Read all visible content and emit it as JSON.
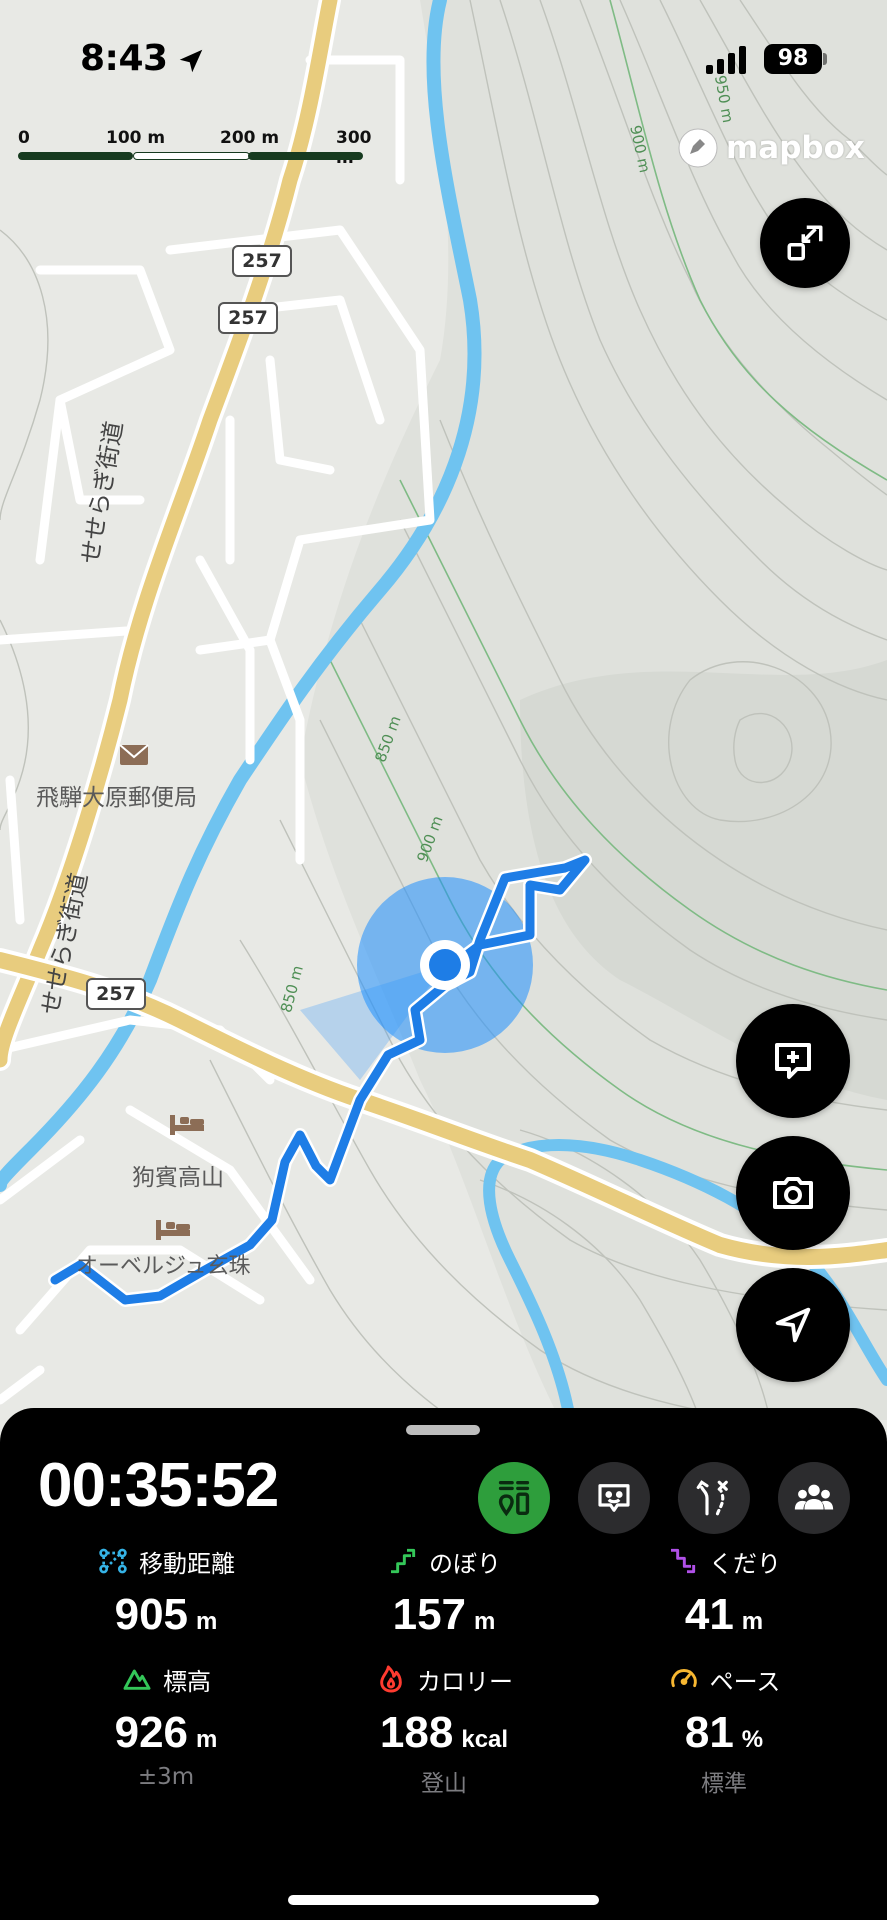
{
  "status_bar": {
    "time": "8:43",
    "battery": "98"
  },
  "map": {
    "scale_labels": [
      "0",
      "100 m",
      "200 m",
      "300 m"
    ],
    "attribution": "mapbox",
    "road_labels": [
      "257",
      "257",
      "257"
    ],
    "street_name": "せせらぎ街道",
    "poi": {
      "post_office": "飛騨大原郵便局",
      "lodging_1": "狗賓高山",
      "lodging_2": "オーベルジュ玄珠"
    },
    "contours": [
      "950 m",
      "900 m",
      "850 m",
      "900 m",
      "850 m"
    ]
  },
  "recording": {
    "elapsed": "00:35:52",
    "stats": [
      {
        "label": "移動距離",
        "value": "905",
        "unit": "m",
        "sub": ""
      },
      {
        "label": "のぼり",
        "value": "157",
        "unit": "m",
        "sub": ""
      },
      {
        "label": "くだり",
        "value": "41",
        "unit": "m",
        "sub": ""
      },
      {
        "label": "標高",
        "value": "926",
        "unit": "m",
        "sub": "±3m"
      },
      {
        "label": "カロリー",
        "value": "188",
        "unit": "kcal",
        "sub": "登山"
      },
      {
        "label": "ペース",
        "value": "81",
        "unit": "%",
        "sub": "標準"
      }
    ]
  },
  "colors": {
    "track": "#1e7de6",
    "road": "#e8cc7e",
    "river": "#6fc3f0",
    "active_toggle": "#2e9e3c",
    "up": "#34c759",
    "down": "#b050e8",
    "distance": "#35b3e6",
    "elevation": "#34c759",
    "calorie": "#ff3b30",
    "pace": "#f7b731"
  }
}
